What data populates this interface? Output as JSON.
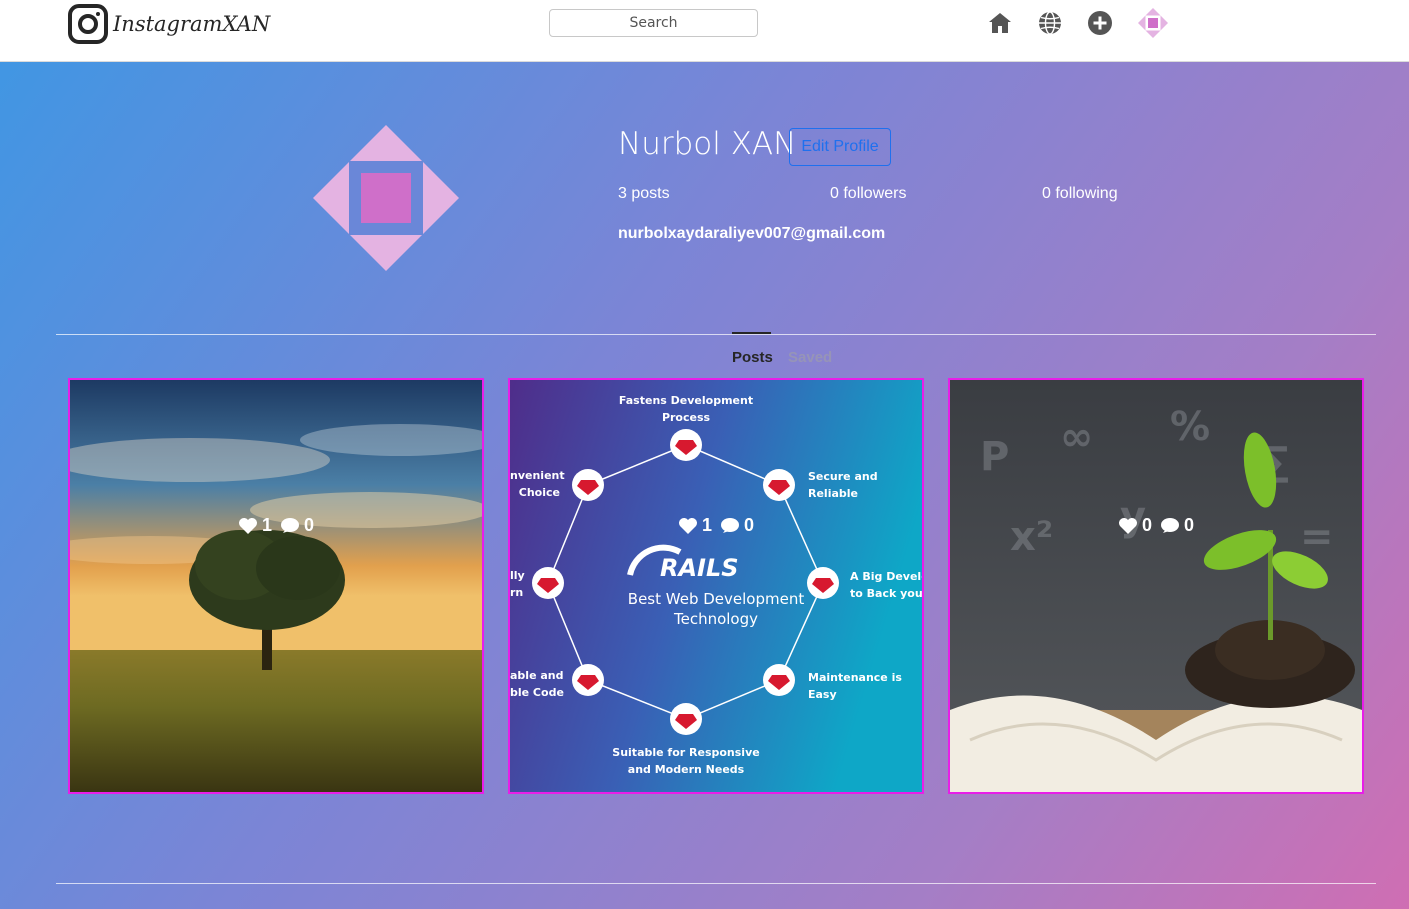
{
  "app": {
    "title": "InstagramXAN"
  },
  "search": {
    "placeholder": "Search"
  },
  "nav": {
    "icons": [
      "home-icon",
      "globe-icon",
      "plus-circle-icon",
      "avatar-icon"
    ]
  },
  "profile": {
    "name": "Nurbol XAN",
    "edit_label": "Edit Profile",
    "posts": "3 posts",
    "followers": "0 followers",
    "following": "0 following",
    "email": "nurbolxaydaraliyev007@gmail.com"
  },
  "tabs": [
    {
      "label": "Posts",
      "active": true
    },
    {
      "label": "Saved",
      "active": false
    }
  ],
  "posts": [
    {
      "likes": "1",
      "comments": "0"
    },
    {
      "likes": "1",
      "comments": "0",
      "image_text": {
        "title": "RAILS",
        "subtitle_1": "Best Web Development",
        "subtitle_2": "Technology",
        "nodes": [
          [
            "Fastens Development",
            "Process"
          ],
          [
            "Secure and",
            "Reliable"
          ],
          [
            "A Big Develo",
            "to Back you"
          ],
          [
            "Maintenance is",
            "Easy"
          ],
          [
            "Suitable for Responsive",
            "and Modern Needs"
          ],
          [
            "able and",
            "ble Code"
          ],
          [
            "lly",
            "rn"
          ],
          [
            "nvenient",
            "Choice"
          ]
        ]
      }
    },
    {
      "likes": "0",
      "comments": "0"
    }
  ],
  "colors": {
    "accent": "#1f70ee",
    "post_border": "#e81ee8",
    "avatar_outer": "#e4b3e2",
    "avatar_inner": "#cf6fc9",
    "avatar_frame": "#6a87d8"
  }
}
